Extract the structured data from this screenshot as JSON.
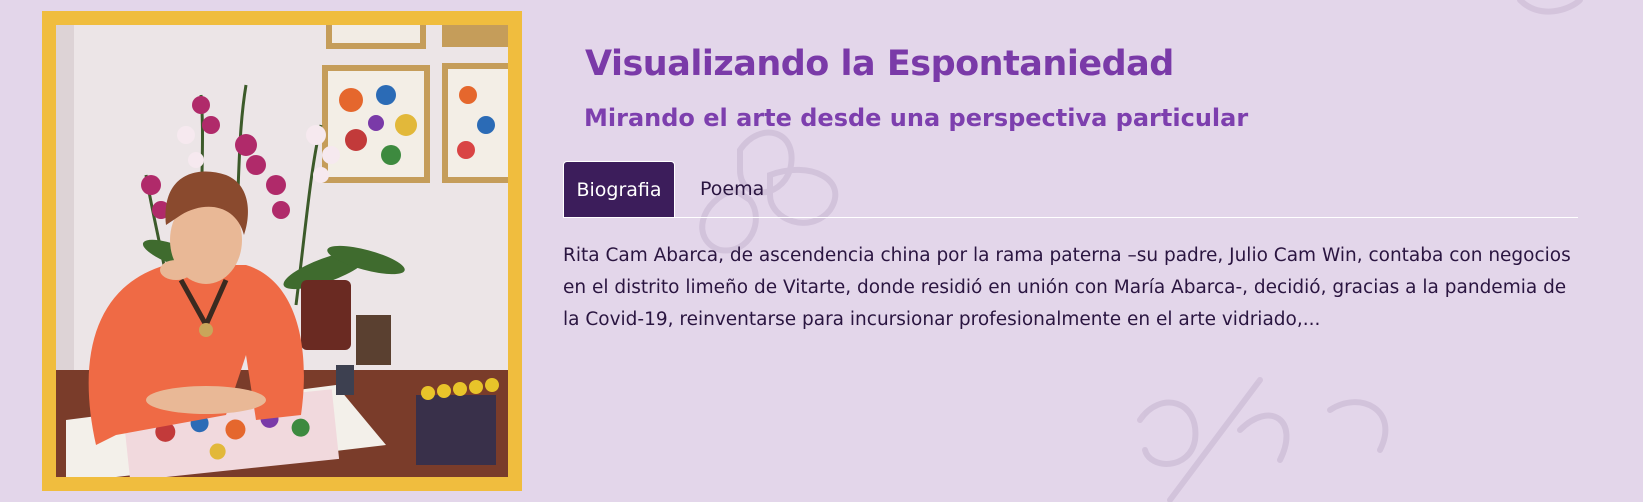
{
  "header": {
    "title": "Visualizando la Espontaniedad",
    "subtitle": "Mirando el arte desde una perspectiva particular"
  },
  "tabs": [
    {
      "label": "Biografia",
      "active": true
    },
    {
      "label": "Poema",
      "active": false
    }
  ],
  "biography": {
    "text": "Rita Cam Abarca, de ascendencia china por la rama paterna –su padre, Julio Cam Win, contaba con negocios en el distrito limeño de Vitarte, donde residió en unión con María Abarca-, decidió, gracias a la pandemia de la Covid-19, reinventarse para incursionar profesionalmente en el arte vidriado,..."
  },
  "colors": {
    "background": "#e3d6ea",
    "frame": "#f0bd3e",
    "title": "#7a3aa8",
    "active_tab": "#3c1d5b",
    "text": "#2a1540"
  }
}
